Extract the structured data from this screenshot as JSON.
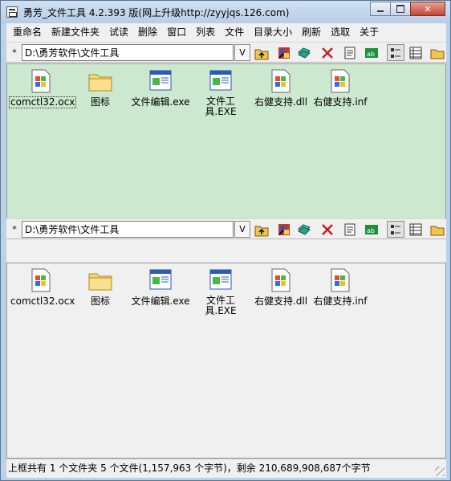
{
  "window": {
    "title": "勇芳_文件工具   4.2.393 版(网上升级http://zyyjqs.126.com)"
  },
  "menu": [
    "重命名",
    "新建文件夹",
    "试读",
    "删除",
    "窗口",
    "列表",
    "文件",
    "目录大小",
    "刷新",
    "选取",
    "关于"
  ],
  "toolbar_star": "*",
  "dropdown_label": "V",
  "panes": {
    "top": {
      "path": "D:\\勇芳软件\\文件工具",
      "files": [
        "comctl32.ocx",
        "图标",
        "文件编辑.exe",
        "文件工具.EXE",
        "右健支持.dll",
        "右健支持.inf"
      ]
    },
    "bottom": {
      "path": "D:\\勇芳软件\\文件工具",
      "files": [
        "comctl32.ocx",
        "图标",
        "文件编辑.exe",
        "文件工具.EXE",
        "右健支持.dll",
        "右健支持.inf"
      ]
    }
  },
  "status": "上框共有 1 个文件夹 5 个文件(1,157,963 个字节)，剩余 210,689,908,687个字节",
  "tool_icons": [
    "up-folder-icon",
    "properties-icon",
    "copy-icon",
    "delete-icon",
    "notes-icon",
    "rename-icon",
    "small-icons-view-icon",
    "details-view-icon",
    "folder-icon"
  ],
  "file_icon_types": [
    "windows-file-icon",
    "folder-icon",
    "app-window-icon",
    "app-window-icon",
    "windows-file-icon",
    "windows-file-icon"
  ]
}
